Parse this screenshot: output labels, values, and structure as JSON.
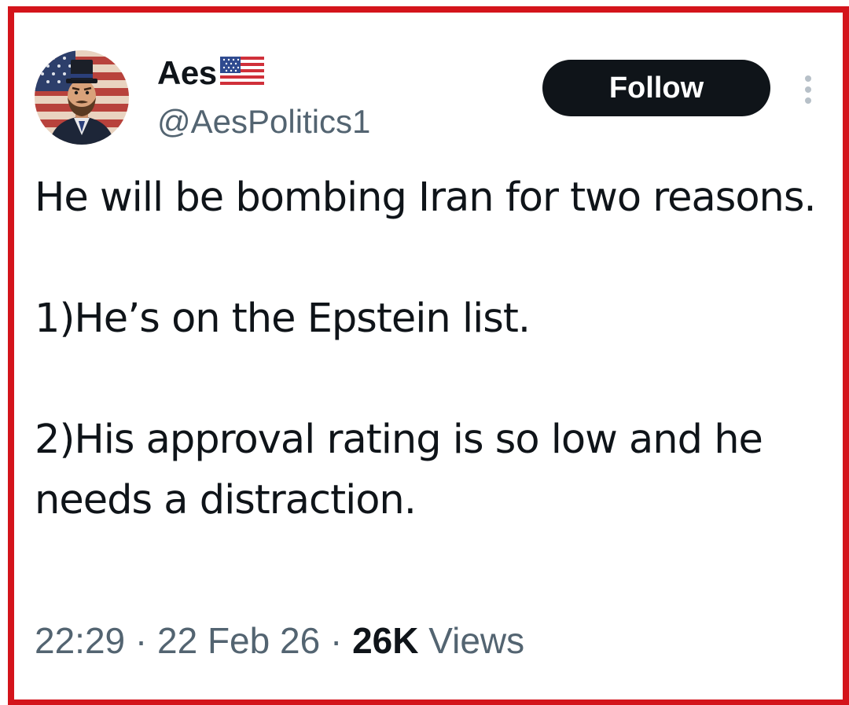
{
  "colors": {
    "frame_border": "#d4141b",
    "text_primary": "#0f1419",
    "text_secondary": "#536471",
    "follow_bg": "#0f1419",
    "follow_text": "#ffffff"
  },
  "tweet": {
    "author": {
      "display_name": "Aes",
      "flag_icon": "us-flag-icon",
      "handle": "@AesPolitics1",
      "avatar_icon": "avatar-top-hat-man"
    },
    "follow_label": "Follow",
    "more_icon": "more-vertical-icon",
    "text_lines": [
      "He will be bombing Iran for two reasons.",
      "",
      "1)He’s on the Epstein list.",
      "",
      "2)His approval rating is so low and he needs a distraction."
    ],
    "time": "22:29",
    "date": "22 Feb 26",
    "separator": "·",
    "views_count": "26K",
    "views_label": "Views"
  }
}
